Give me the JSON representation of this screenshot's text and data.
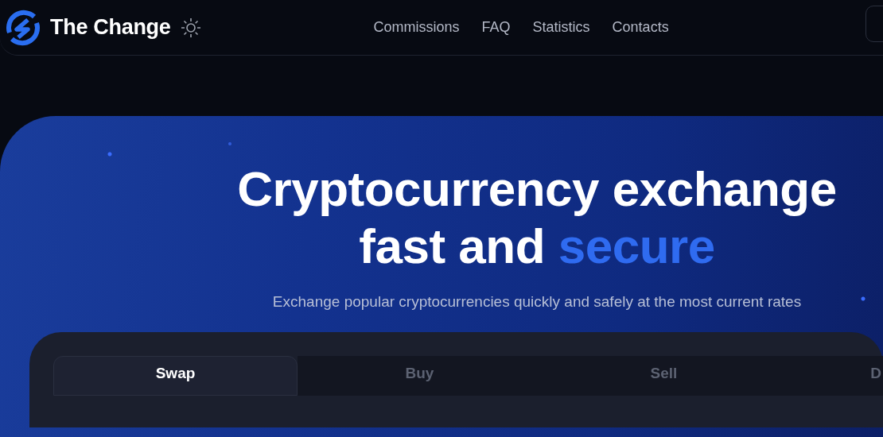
{
  "header": {
    "brand": "The Change",
    "nav": [
      {
        "label": "Commissions"
      },
      {
        "label": "FAQ"
      },
      {
        "label": "Statistics"
      },
      {
        "label": "Contacts"
      }
    ]
  },
  "hero": {
    "title_line_1": "Cryptocurrency exchange",
    "title_line_2_plain": "fast and",
    "title_line_2_accent": "secure",
    "subtitle": "Exchange popular cryptocurrencies quickly and safely at the most current rates"
  },
  "exchange": {
    "tabs": [
      {
        "label": "Swap",
        "selected": true
      },
      {
        "label": "Buy",
        "selected": false
      },
      {
        "label": "Sell",
        "selected": false
      },
      {
        "label": "D",
        "selected": false
      }
    ]
  }
}
